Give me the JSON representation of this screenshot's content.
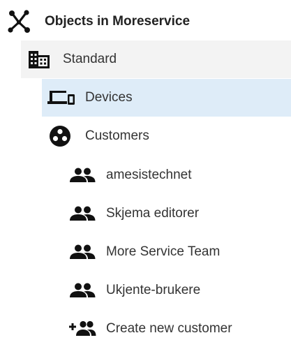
{
  "colors": {
    "selected_background": "#deecf8",
    "hover_background": "#f3f3f3",
    "icon_color": "#111111",
    "text_color": "#333333"
  },
  "tree": {
    "root": {
      "label": "Objects in Moreservice",
      "icon": "network-hub-icon"
    },
    "standard": {
      "label": "Standard",
      "icon": "building-icon"
    },
    "devices": {
      "label": "Devices",
      "icon": "devices-icon",
      "selected": true
    },
    "customers": {
      "label": "Customers",
      "icon": "group-circle-icon",
      "items": [
        {
          "label": "amesistechnet",
          "icon": "people-icon"
        },
        {
          "label": "Skjema editorer",
          "icon": "people-icon"
        },
        {
          "label": "More Service Team",
          "icon": "people-icon"
        },
        {
          "label": "Ukjente-brukere",
          "icon": "people-icon"
        }
      ],
      "create": {
        "label": "Create new customer",
        "icon": "add-people-icon"
      }
    }
  }
}
